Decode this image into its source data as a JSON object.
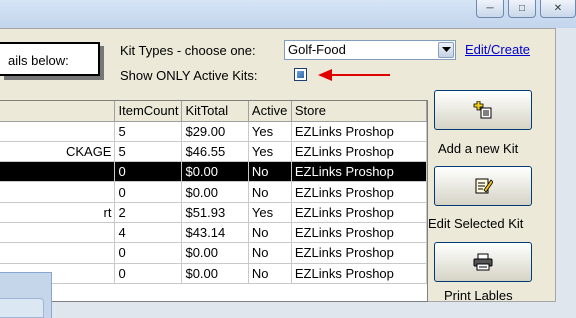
{
  "window": {
    "controls": [
      "minimize-icon",
      "maximize-icon",
      "close-icon"
    ]
  },
  "form": {
    "instruction": "ails below:",
    "kit_types_label": "Kit Types - choose one:",
    "kit_type_value": "Golf-Food",
    "edit_create_link": "Edit/Create",
    "active_only_label": "Show ONLY Active Kits:",
    "active_only_checked": true
  },
  "grid": {
    "columns": [
      "",
      "ItemCount",
      "KitTotal",
      "Active",
      "Store"
    ],
    "rows": [
      {
        "name": "",
        "count": "5",
        "total": "$29.00",
        "active": "Yes",
        "store": "EZLinks Proshop"
      },
      {
        "name": "CKAGE",
        "count": "5",
        "total": "$46.55",
        "active": "Yes",
        "store": "EZLinks Proshop"
      },
      {
        "name": "",
        "count": "0",
        "total": "$0.00",
        "active": "No",
        "store": "EZLinks Proshop",
        "selected": true
      },
      {
        "name": "",
        "count": "0",
        "total": "$0.00",
        "active": "No",
        "store": "EZLinks Proshop"
      },
      {
        "name": "rt",
        "count": "2",
        "total": "$51.93",
        "active": "Yes",
        "store": "EZLinks Proshop"
      },
      {
        "name": "",
        "count": "4",
        "total": "$43.14",
        "active": "No",
        "store": "EZLinks Proshop"
      },
      {
        "name": "",
        "count": "0",
        "total": "$0.00",
        "active": "No",
        "store": "EZLinks Proshop"
      },
      {
        "name": "",
        "count": "0",
        "total": "$0.00",
        "active": "No",
        "store": "EZLinks Proshop"
      }
    ]
  },
  "buttons": {
    "add_kit": "Add a new Kit",
    "edit_kit": "Edit Selected Kit",
    "print_labels": "Print Lables"
  },
  "colors": {
    "panel": "#ece9d8",
    "link": "#0000cc",
    "selected_row": "#000000",
    "annotation_arrow": "#e00000"
  }
}
